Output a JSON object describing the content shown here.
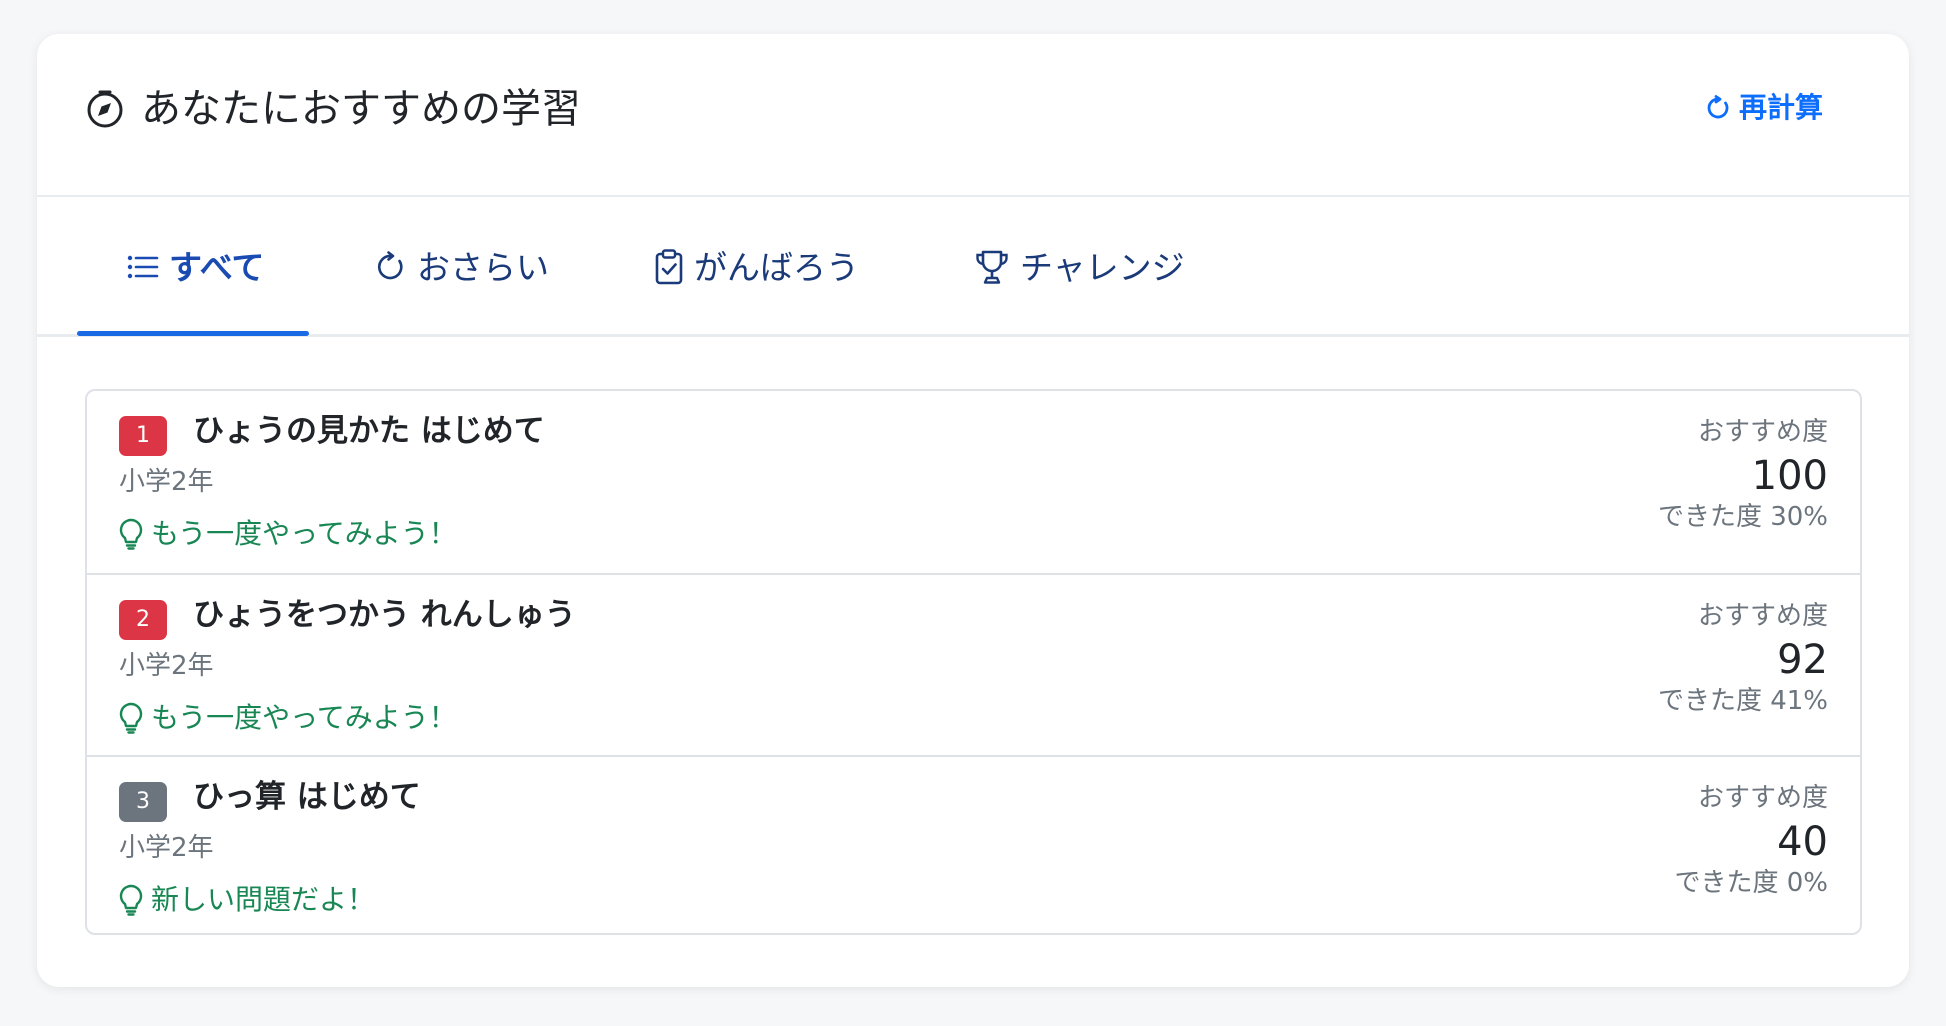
{
  "header": {
    "title": "あなたにおすすめの学習",
    "recalc_label": "再計算",
    "title_icon": "compass-icon",
    "recalc_icon": "refresh-icon"
  },
  "tabs": [
    {
      "label": "すべて",
      "icon": "list-icon",
      "active": true
    },
    {
      "label": "おさらい",
      "icon": "refresh-icon",
      "active": false
    },
    {
      "label": "がんばろう",
      "icon": "clipboard-check-icon",
      "active": false
    },
    {
      "label": "チャレンジ",
      "icon": "trophy-icon",
      "active": false
    }
  ],
  "items": [
    {
      "rank": "1",
      "rank_color": "#dc3545",
      "title": "ひょうの見かた はじめて",
      "grade": "小学2年",
      "hint": "もう一度やってみよう！",
      "score_label": "おすすめ度",
      "score": "100",
      "done": "できた度 30%"
    },
    {
      "rank": "2",
      "rank_color": "#dc3545",
      "title": "ひょうをつかう れんしゅう",
      "grade": "小学2年",
      "hint": "もう一度やってみよう！",
      "score_label": "おすすめ度",
      "score": "92",
      "done": "できた度 41%"
    },
    {
      "rank": "3",
      "rank_color": "#6c757d",
      "title": "ひっ算 はじめて",
      "grade": "小学2年",
      "hint": "新しい問題だよ！",
      "score_label": "おすすめ度",
      "score": "40",
      "done": "できた度 0%"
    }
  ],
  "colors": {
    "accent": "#0d6efd",
    "tab_active": "#1a4bb3",
    "hint": "#198754",
    "badge_red": "#dc3545",
    "badge_gray": "#6c757d"
  }
}
